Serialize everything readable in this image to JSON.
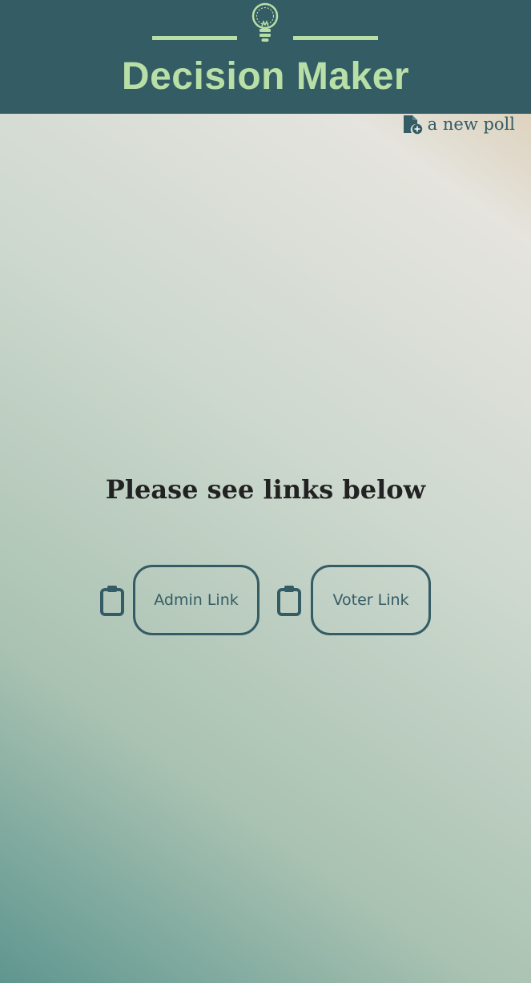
{
  "header": {
    "logo_icon": "lightbulb-icon",
    "title": "Decision Maker"
  },
  "nav": {
    "new_poll_icon": "file-plus-icon",
    "new_poll_label": "a new poll"
  },
  "main": {
    "heading": "Please see links below",
    "links": [
      {
        "icon": "clipboard-icon",
        "label": "Admin Link"
      },
      {
        "icon": "clipboard-icon",
        "label": "Voter Link"
      }
    ]
  },
  "colors": {
    "header_bg": "#345c65",
    "logo_accent": "#b8dfa6",
    "button_border": "#345c65"
  }
}
